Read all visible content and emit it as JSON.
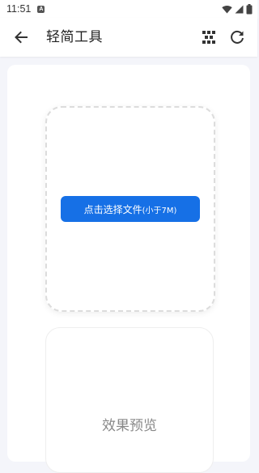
{
  "status_bar": {
    "time": "11:51",
    "notification_icon": "A",
    "icons": [
      "wifi-icon",
      "cellular-signal-icon",
      "battery-icon"
    ]
  },
  "app_bar": {
    "title": "轻简工具",
    "back_icon": "arrow-left-icon",
    "actions": [
      "qr-scan-icon",
      "refresh-icon"
    ]
  },
  "upload": {
    "button_label": "点击选择文件",
    "button_sub_label": "(小于7M)"
  },
  "preview": {
    "label": "效果预览"
  },
  "colors": {
    "accent": "#1670e6",
    "background": "#f4f5fa",
    "card": "#ffffff"
  }
}
